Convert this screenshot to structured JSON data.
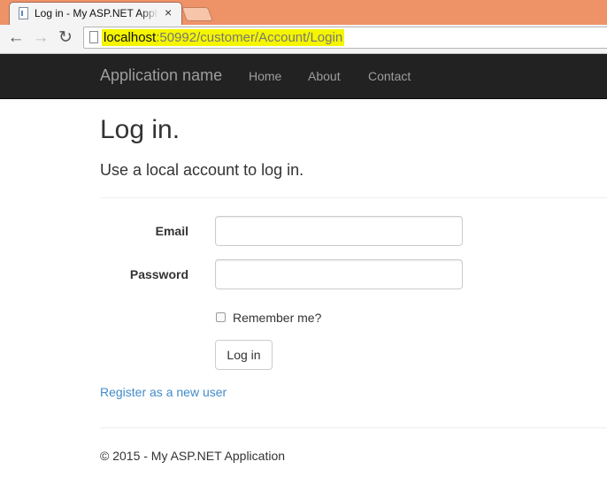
{
  "browser": {
    "tab_title": "Log in - My ASP.NET Appl",
    "tab_close": "×",
    "back_glyph": "←",
    "forward_glyph": "→",
    "reload_glyph": "↻",
    "url_host": "localhost",
    "url_rest": ":50992/customer/Account/Login",
    "url_highlight_color": "#f5f500"
  },
  "navbar": {
    "brand": "Application name",
    "links": [
      "Home",
      "About",
      "Contact"
    ]
  },
  "page": {
    "title": "Log in.",
    "subtitle": "Use a local account to log in.",
    "email_label": "Email",
    "email_value": "",
    "password_label": "Password",
    "password_value": "",
    "remember_label": "Remember me?",
    "remember_checked": false,
    "login_button": "Log in",
    "register_link": "Register as a new user"
  },
  "footer": {
    "text": "© 2015 - My ASP.NET Application"
  },
  "colors": {
    "tabstrip": "#ee9268",
    "navbar": "#222222",
    "link": "#428bca"
  },
  "icons": {
    "tab_favicon": "page-icon",
    "back": "back-arrow-icon",
    "forward": "forward-arrow-icon",
    "reload": "reload-icon",
    "omnibox_page": "document-icon"
  }
}
